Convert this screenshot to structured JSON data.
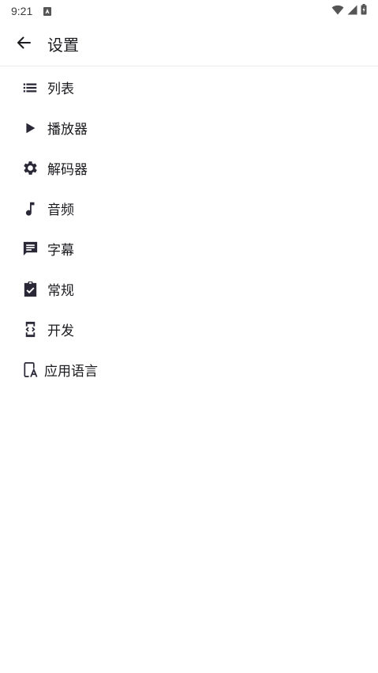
{
  "status": {
    "time": "9:21"
  },
  "header": {
    "title": "设置"
  },
  "menu": [
    {
      "label": "列表",
      "icon": "list-icon"
    },
    {
      "label": "播放器",
      "icon": "play-icon"
    },
    {
      "label": "解码器",
      "icon": "gear-icon"
    },
    {
      "label": "音频",
      "icon": "music-note-icon"
    },
    {
      "label": "字幕",
      "icon": "subtitle-icon"
    },
    {
      "label": "常规",
      "icon": "clipboard-check-icon"
    },
    {
      "label": "开发",
      "icon": "developer-mode-icon"
    },
    {
      "label": "应用语言",
      "icon": "app-language-icon"
    }
  ],
  "colors": {
    "icon": "#2a2837",
    "text": "#1c1b1f",
    "divider": "#ececec"
  }
}
